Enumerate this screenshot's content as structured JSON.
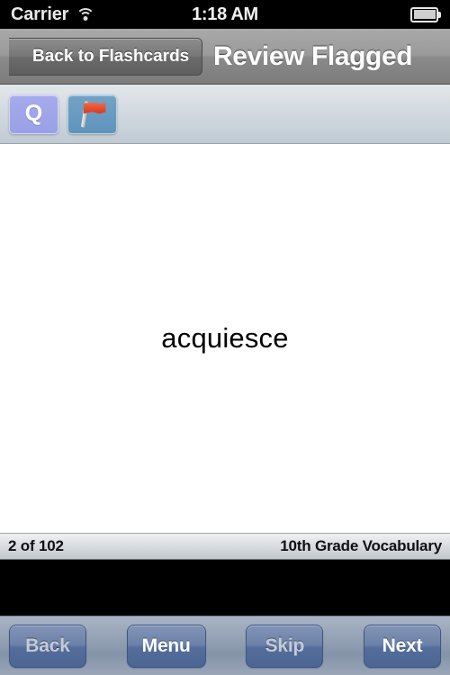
{
  "status_bar": {
    "carrier": "Carrier",
    "wifi_icon": "wifi-icon",
    "time": "1:18 AM",
    "battery_icon": "battery-icon"
  },
  "nav_bar": {
    "back_label": "Back to Flashcards",
    "title": "Review Flagged"
  },
  "sub_toolbar": {
    "side_label": "Q",
    "flag_icon": "red-flag-icon"
  },
  "card": {
    "word": "acquiesce"
  },
  "footer": {
    "progress": "2 of 102",
    "deck": "10th Grade Vocabulary"
  },
  "bottom_toolbar": {
    "back": "Back",
    "menu": "Menu",
    "skip": "Skip",
    "next": "Next"
  },
  "colors": {
    "q_button": "#9aa0e6",
    "flag_button": "#6094bb",
    "toolbar_button": "#546d9b",
    "nav_bar": "#8a8a8a",
    "card_background": "#ffffff"
  }
}
